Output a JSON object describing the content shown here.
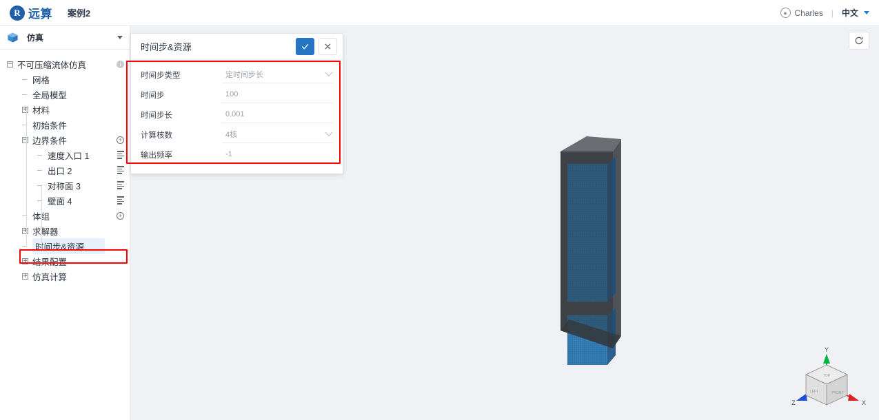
{
  "topbar": {
    "logo_mark": "R",
    "logo_text": "远算",
    "case_name": "案例2",
    "user_name": "Charles",
    "divider": "|",
    "language": "中文",
    "user_icon": "user-circle-icon",
    "caret_icon": "chevron-down-icon"
  },
  "sidebar": {
    "header": {
      "label": "仿真",
      "icon": "cube-icon",
      "caret": "chevron-down-icon"
    },
    "tree": [
      {
        "label": "不可压缩流体仿真",
        "indent": 0,
        "marker": "minus",
        "right": "info",
        "selected": false
      },
      {
        "label": "网格",
        "indent": 1,
        "marker": "dash",
        "right": "none",
        "selected": false
      },
      {
        "label": "全局模型",
        "indent": 1,
        "marker": "dash",
        "right": "none",
        "selected": false
      },
      {
        "label": "材料",
        "indent": 1,
        "marker": "plus-box",
        "right": "none",
        "selected": false
      },
      {
        "label": "初始条件",
        "indent": 1,
        "marker": "dash",
        "right": "none",
        "selected": false
      },
      {
        "label": "边界条件",
        "indent": 1,
        "marker": "minus",
        "right": "plus",
        "selected": false
      },
      {
        "label": "速度入口 1",
        "indent": 2,
        "marker": "dash",
        "right": "list",
        "selected": false
      },
      {
        "label": "出口 2",
        "indent": 2,
        "marker": "dash",
        "right": "list",
        "selected": false
      },
      {
        "label": "对称面 3",
        "indent": 2,
        "marker": "dash",
        "right": "list",
        "selected": false
      },
      {
        "label": "壁面 4",
        "indent": 2,
        "marker": "dash",
        "right": "list",
        "selected": false
      },
      {
        "label": "体组",
        "indent": 1,
        "marker": "dash",
        "right": "plus",
        "selected": false
      },
      {
        "label": "求解器",
        "indent": 1,
        "marker": "plus-box",
        "right": "none",
        "selected": false
      },
      {
        "label": "时间步&资源",
        "indent": 1,
        "marker": "dash",
        "right": "none",
        "selected": true
      },
      {
        "label": "结果配置",
        "indent": 1,
        "marker": "plus-box",
        "right": "none",
        "selected": false
      },
      {
        "label": "仿真计算",
        "indent": 1,
        "marker": "plus-box",
        "right": "none",
        "selected": false
      }
    ]
  },
  "panel": {
    "title": "时间步&资源",
    "confirm_icon": "check-icon",
    "cancel_icon": "close-icon",
    "fields": [
      {
        "label": "时间步类型",
        "value": "定时间步长",
        "type": "select"
      },
      {
        "label": "时间步",
        "value": "100",
        "type": "text"
      },
      {
        "label": "时间步长",
        "value": "0.001",
        "type": "text"
      },
      {
        "label": "计算核数",
        "value": "4核",
        "type": "select"
      },
      {
        "label": "输出频率",
        "value": "-1",
        "type": "text"
      }
    ]
  },
  "viewport": {
    "reset_icon": "refresh-icon",
    "axis": {
      "x_label": "X",
      "y_label": "Y",
      "z_label": "Z",
      "x_color": "#e02020",
      "y_color": "#00b33c",
      "z_color": "#1a4fd6"
    },
    "cube_faces": [
      "LEFT",
      "TOP",
      "FRONT"
    ],
    "model": {
      "body_color": "#4a4d51",
      "mesh_color": "#1f6aa5"
    }
  },
  "annotations": {
    "panel_box_color": "#ff0000",
    "tree_box_color": "#ff0000"
  }
}
